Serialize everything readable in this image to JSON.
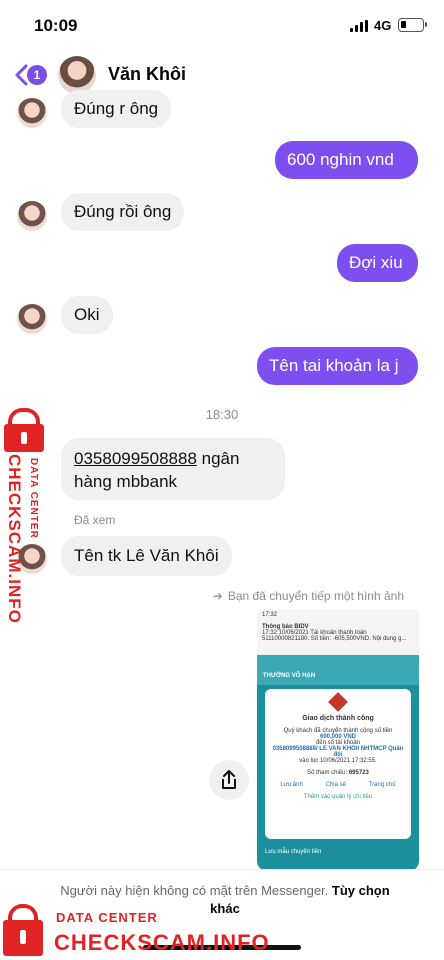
{
  "status_bar": {
    "time": "10:09",
    "network": "4G"
  },
  "header": {
    "back_badge": "1",
    "contact_name": "Văn Khôi"
  },
  "messages": [
    {
      "from": "contact",
      "text": "Đúng r ông"
    },
    {
      "from": "me",
      "text": "600 nghin vnd"
    },
    {
      "from": "contact",
      "text": "Đúng rồi ông"
    },
    {
      "from": "me",
      "text": "Đợi xiu"
    },
    {
      "from": "contact",
      "text": "Oki"
    },
    {
      "from": "me",
      "text": "Tên tai khoản la j"
    },
    {
      "from": "contact",
      "text_part1": "0358099508888",
      "text_part2": " ngân hàng mbbank"
    },
    {
      "from": "contact",
      "text": "Tên tk Lê Văn Khôi"
    }
  ],
  "time_separator": "18:30",
  "seen_label": "Đã xem",
  "forward_note": "Bạn đã chuyển tiếp một hình ảnh",
  "forwarded_image": {
    "time": "17:32",
    "notification_title": "Thông báo BIDV",
    "notification_text": "17:32 10/06/2021 Tài khoản thanh toán 51110000821180. Số tiền: -605,500VND. Nội dung g...",
    "banner": "THƯỞNG VÔ HẠN",
    "card_title": "Giao dịch thành công",
    "card_line1": "Quý khách đã chuyển thành công số tiền",
    "card_amount": "600,000 VND",
    "card_line2": "đến số tài khoản",
    "card_account": "0358099508888/ LE VAN KHOI/ NHTMCP Quân đội",
    "card_line3": "vào lúc 10/06/2021 17:32:55.",
    "ref_label": "Số tham chiếu:",
    "ref_value": "695723",
    "actions": [
      "Lưu ảnh",
      "Chia sẻ",
      "Trang chủ"
    ],
    "beneficiary_link": "Thêm vào quản lý chi tiêu",
    "save_template": "Lưu mẫu chuyển tiền"
  },
  "bottom": {
    "message": "Người này hiện không có mặt trên Messenger.",
    "link": "Tùy chọn khác"
  },
  "watermark": {
    "line1": "DATA CENTER",
    "line2": "CHECKSCAM.INFO"
  },
  "colors": {
    "accent": "#7e4ff0",
    "incoming_bubble": "#f0f0f0",
    "watermark": "#e02424"
  }
}
